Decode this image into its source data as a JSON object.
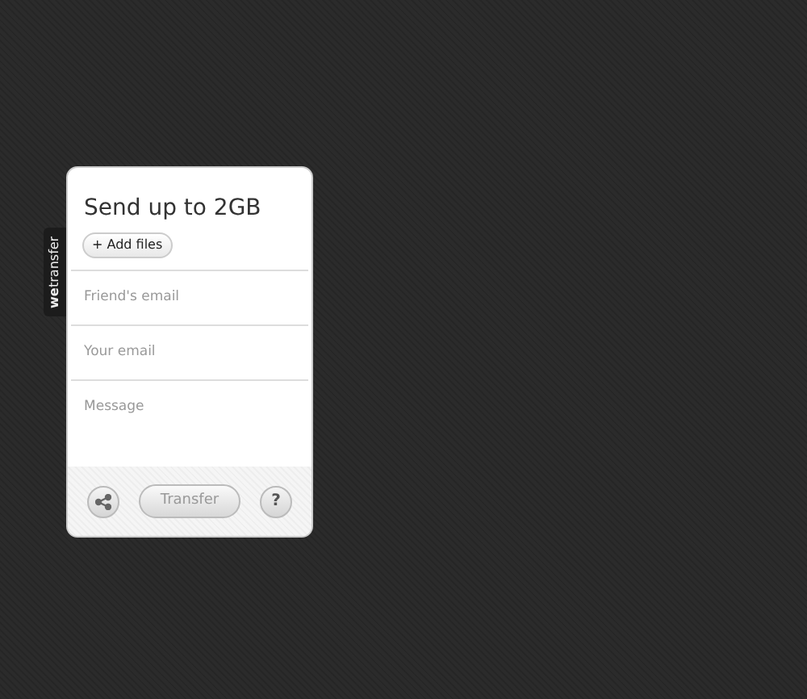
{
  "side_tab": {
    "label": "**we**transfer"
  },
  "panel": {
    "title": "Send up to 2GB",
    "add_files": "+ Add files",
    "fields": [
      {
        "kind": "input",
        "placeholder": "Friend's email"
      },
      {
        "kind": "input",
        "placeholder": "Your email"
      },
      {
        "kind": "textarea",
        "placeholder": "Message"
      }
    ],
    "footer": {
      "transfer": "Transfer",
      "help": "?"
    }
  }
}
